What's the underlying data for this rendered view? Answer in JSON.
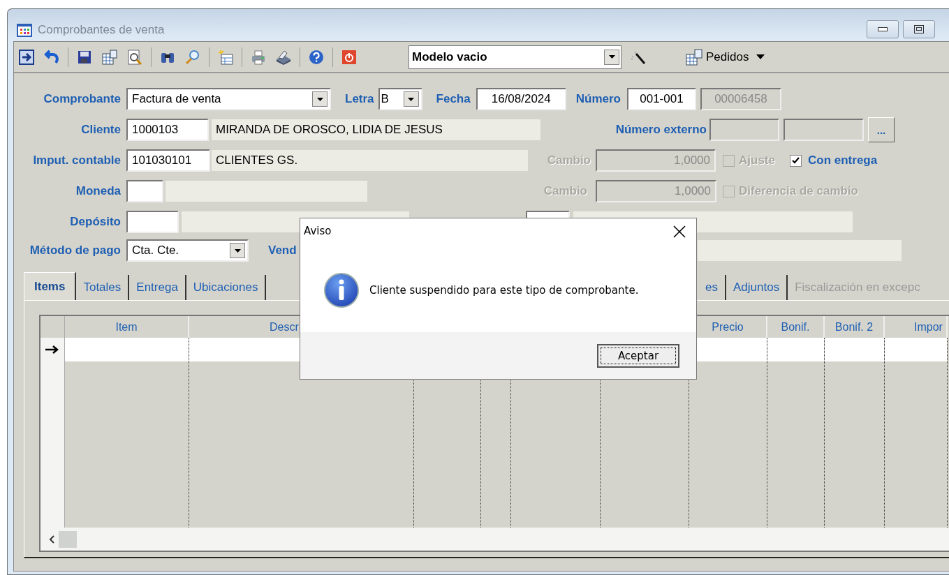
{
  "window": {
    "title": "Comprobantes de venta"
  },
  "toolbar": {
    "model": "Modelo vacio",
    "pedidos": "Pedidos"
  },
  "form": {
    "comprobante": {
      "label": "Comprobante",
      "value": "Factura de venta"
    },
    "letra": {
      "label": "Letra",
      "value": "B"
    },
    "fecha": {
      "label": "Fecha",
      "value": "16/08/2024"
    },
    "numero": {
      "label": "Número",
      "prefix": "001-001",
      "value": "00006458",
      "value_disabled": true
    },
    "cliente": {
      "label": "Cliente",
      "code": "1000103",
      "name": "MIRANDA DE OROSCO, LIDIA DE JESUS"
    },
    "numero_externo": {
      "label": "Número externo",
      "button": "..."
    },
    "imput_contable": {
      "label": "Imput. contable",
      "code": "101030101",
      "name": "CLIENTES GS."
    },
    "cambio": {
      "label": "Cambio",
      "value": "1,0000",
      "disabled": true
    },
    "ajuste": {
      "label": "Ajuste",
      "checked": false,
      "disabled": true
    },
    "con_entrega": {
      "label": "Con entrega",
      "checked": true,
      "disabled": false
    },
    "moneda": {
      "label": "Moneda"
    },
    "cambio_2": {
      "label": "Cambio",
      "value": "1,0000",
      "disabled": true
    },
    "diferencia_de_cambio": {
      "label": "Diferencia de cambio",
      "checked": false,
      "disabled": true
    },
    "deposito": {
      "label": "Depósito"
    },
    "metodo_de_pago": {
      "label": "Método de pago",
      "value": "Cta. Cte."
    },
    "vendedor": {
      "label": "Vend"
    }
  },
  "tabs": [
    {
      "label": "Items",
      "selected": true,
      "disabled": false
    },
    {
      "label": "Totales",
      "selected": false,
      "disabled": false
    },
    {
      "label": "Entrega",
      "selected": false,
      "disabled": false
    },
    {
      "label": "Ubicaciones",
      "selected": false,
      "disabled": false
    },
    {
      "label": "es",
      "selected": false,
      "disabled": false
    },
    {
      "label": "Adjuntos",
      "selected": false,
      "disabled": false
    },
    {
      "label": "Fiscalización en excepc",
      "selected": false,
      "disabled": true
    }
  ],
  "grid": {
    "columns": [
      {
        "label": "Item"
      },
      {
        "label": "Descr"
      },
      {
        "label": "Precio"
      },
      {
        "label": "Bonif."
      },
      {
        "label": "Bonif. 2"
      },
      {
        "label": "Impor"
      }
    ]
  },
  "dialog": {
    "title": "Aviso",
    "message": "Cliente suspendido para este tipo de comprobante.",
    "button": "Aceptar"
  }
}
